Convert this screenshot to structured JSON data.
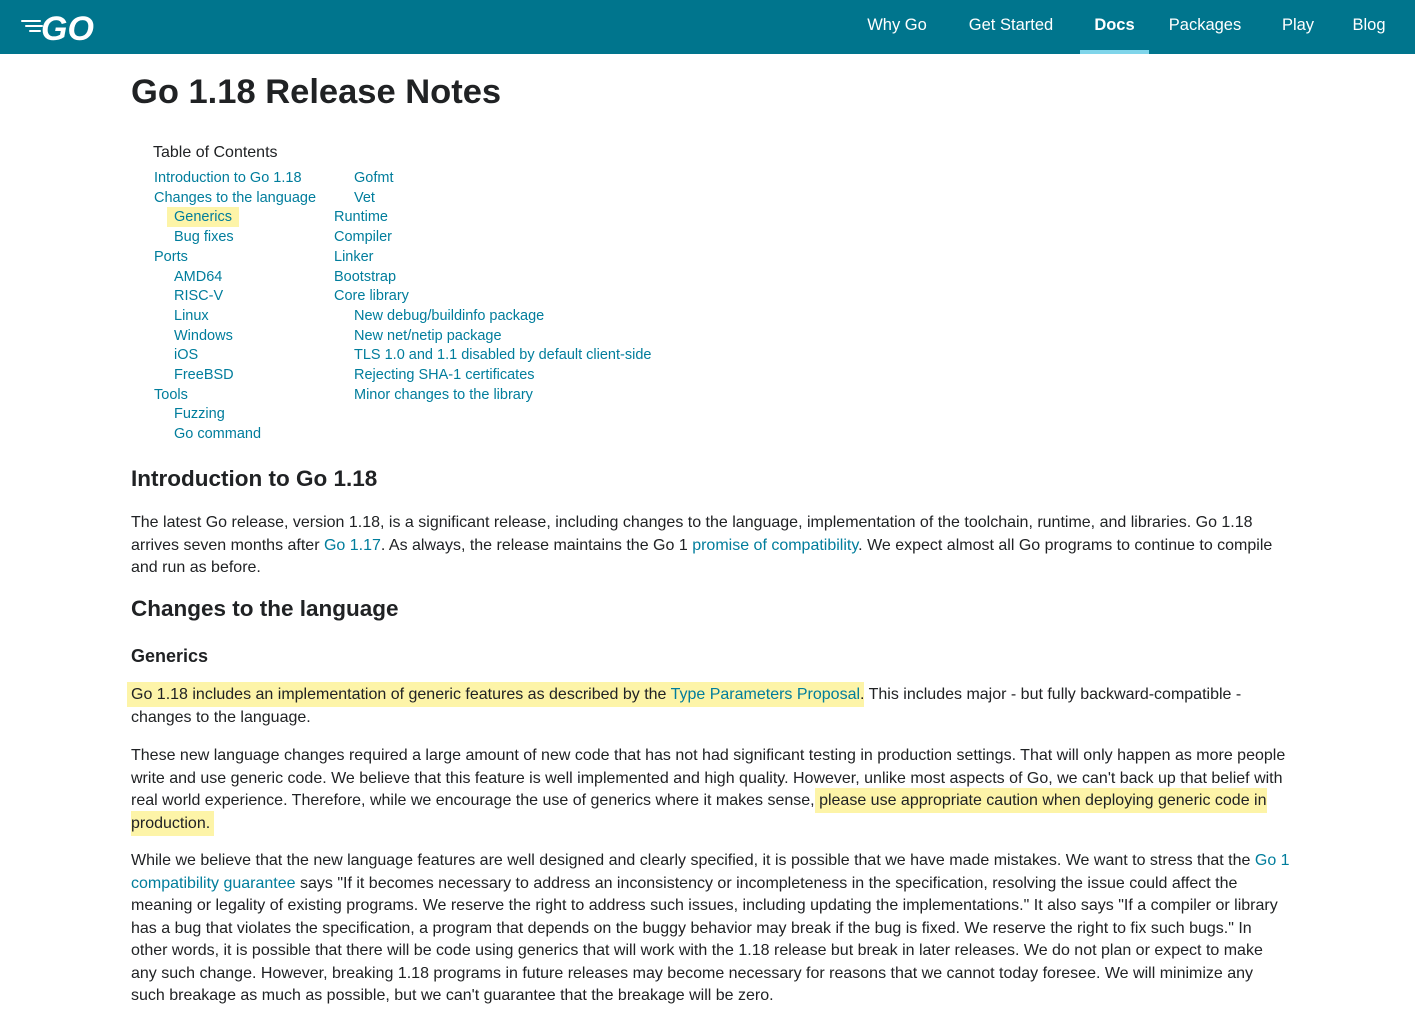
{
  "header": {
    "logo": "GO",
    "nav": [
      {
        "label": "Why Go",
        "name": "nav-why-go",
        "active": false
      },
      {
        "label": "Get Started",
        "name": "nav-get-started",
        "active": false
      },
      {
        "label": "Docs",
        "name": "nav-docs",
        "active": true
      },
      {
        "label": "Packages",
        "name": "nav-packages",
        "active": false
      },
      {
        "label": "Play",
        "name": "nav-play",
        "active": false
      },
      {
        "label": "Blog",
        "name": "nav-blog",
        "active": false
      }
    ]
  },
  "page": {
    "title": "Go 1.18 Release Notes"
  },
  "toc": {
    "title": "Table of Contents",
    "col1": [
      {
        "label": "Introduction to Go 1.18",
        "level": 0
      },
      {
        "label": "Changes to the language",
        "level": 0
      },
      {
        "label": "Generics",
        "level": 1,
        "highlighted": true
      },
      {
        "label": "Bug fixes",
        "level": 1
      },
      {
        "label": "Ports",
        "level": 0
      },
      {
        "label": "AMD64",
        "level": 1
      },
      {
        "label": "RISC-V",
        "level": 1
      },
      {
        "label": "Linux",
        "level": 1
      },
      {
        "label": "Windows",
        "level": 1
      },
      {
        "label": "iOS",
        "level": 1
      },
      {
        "label": "FreeBSD",
        "level": 1
      },
      {
        "label": "Tools",
        "level": 0
      },
      {
        "label": "Fuzzing",
        "level": 1
      },
      {
        "label": "Go command",
        "level": 1
      }
    ],
    "col2": [
      {
        "label": "Gofmt",
        "level": 1
      },
      {
        "label": "Vet",
        "level": 1
      },
      {
        "label": "Runtime",
        "level": 0
      },
      {
        "label": "Compiler",
        "level": 0
      },
      {
        "label": "Linker",
        "level": 0
      },
      {
        "label": "Bootstrap",
        "level": 0
      },
      {
        "label": "Core library",
        "level": 0
      },
      {
        "label": "New debug/buildinfo package",
        "level": 1
      },
      {
        "label": "New net/netip package",
        "level": 1
      },
      {
        "label": "TLS 1.0 and 1.1 disabled by default client-side",
        "level": 1
      },
      {
        "label": "Rejecting SHA-1 certificates",
        "level": 1
      },
      {
        "label": "Minor changes to the library",
        "level": 1
      }
    ]
  },
  "intro": {
    "heading": "Introduction to Go 1.18",
    "p1_a": "The latest Go release, version 1.18, is a significant release, including changes to the language, implementation of the toolchain, runtime, and libraries. Go 1.18 arrives seven months after ",
    "p1_link1": "Go 1.17",
    "p1_b": ". As always, the release maintains the Go 1 ",
    "p1_link2": "promise of compatibility",
    "p1_c": ". We expect almost all Go programs to continue to compile and run as before."
  },
  "language": {
    "heading": "Changes to the language",
    "generics_heading": "Generics",
    "p1_a": "Go 1.18 includes an implementation of generic features as described by the ",
    "p1_link": "Type Parameters Proposal",
    "p1_b": ". This includes major - but fully backward-compatible - changes to the language.",
    "p2_a": "These new language changes required a large amount of new code that has not had significant testing in production settings. That will only happen as more people write and use generic code. We believe that this feature is well implemented and high quality. However, unlike most aspects of Go, we can't back up that belief with real world experience. Therefore, while we encourage the use of generics where it makes sense, ",
    "p2_highlight": "please use appropriate caution when deploying generic code in production.",
    "p3_a": "While we believe that the new language features are well designed and clearly specified, it is possible that we have made mistakes. We want to stress that the ",
    "p3_link": "Go 1 compatibility guarantee",
    "p3_b": " says \"If it becomes necessary to address an inconsistency or incompleteness in the specification, resolving the issue could affect the meaning or legality of existing programs. We reserve the right to address such issues, including updating the implementations.\" It also says \"If a compiler or library has a bug that violates the specification, a program that depends on the buggy behavior may break if the bug is fixed. We reserve the right to fix such bugs.\" In other words, it is possible that there will be code using generics that will work with the 1.18 release but break in later releases. We do not plan or expect to make any such change. However, breaking 1.18 programs in future releases may become necessary for reasons that we cannot today foresee. We will minimize any such breakage as much as possible, but we can't guarantee that the breakage will be zero."
  },
  "colors": {
    "header_bg": "#00758d",
    "link": "#007d9c",
    "highlight": "#fdf4a8",
    "nav_active_underline": "#7fd5ea"
  }
}
